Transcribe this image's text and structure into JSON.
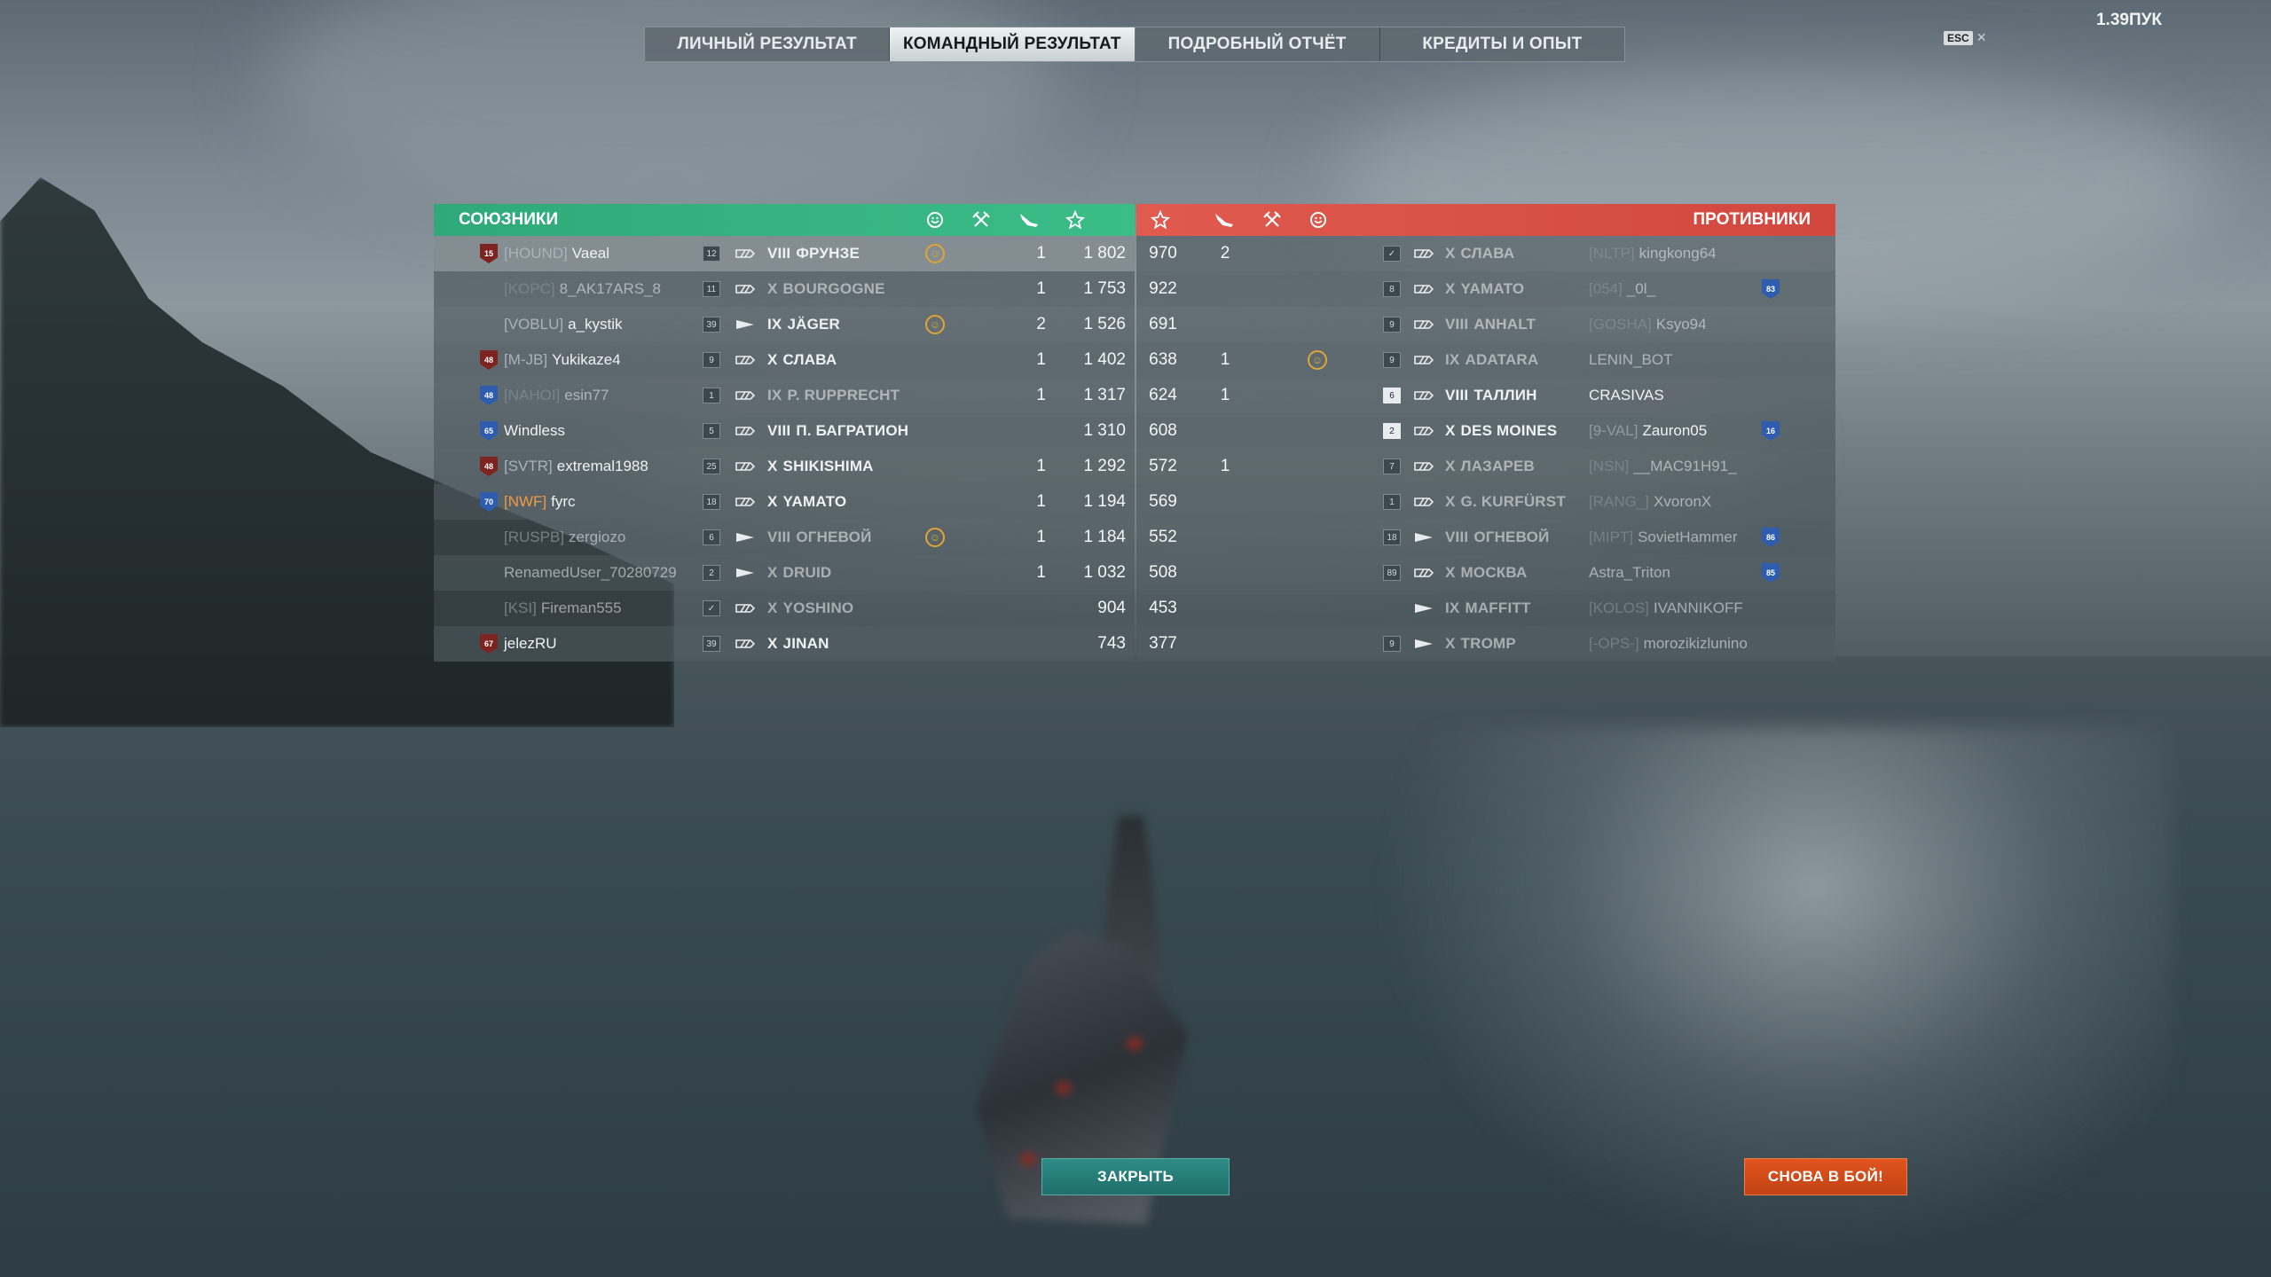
{
  "tabs": [
    "ЛИЧНЫЙ РЕЗУЛЬТАТ",
    "КОМАНДНЫЙ РЕЗУЛЬТАТ",
    "ПОДРОБНЫЙ ОТЧЁТ",
    "КРЕДИТЫ И ОПЫТ"
  ],
  "active_tab": 1,
  "esc_label": "ESC",
  "ping": "1.39ПУК",
  "allies": {
    "title": "СОЮЗНИКИ",
    "header_icons": [
      "medal-icon",
      "crossed-swords-icon",
      "plane-icon",
      "star-icon"
    ],
    "rows": [
      {
        "rank_badge": "15",
        "rank_color": "red",
        "clan": "[HOUND]",
        "clan_style": "normal",
        "player": "Vaeal",
        "level": "12",
        "level_white": false,
        "ship_type": "battleship",
        "tier": "VIII",
        "ship": "ФРУНЗЕ",
        "medal": true,
        "kills": "1",
        "score": "1 802",
        "dim": false,
        "highlight": true
      },
      {
        "rank_badge": "",
        "rank_color": "",
        "clan": "[KOPC]",
        "clan_style": "faded",
        "player": "8_AK17ARS_8",
        "level": "11",
        "level_white": false,
        "ship_type": "battleship",
        "tier": "X",
        "ship": "BOURGOGNE",
        "medal": false,
        "kills": "1",
        "score": "1 753",
        "dim": true,
        "highlight": false
      },
      {
        "rank_badge": "",
        "rank_color": "",
        "clan": "[VOBLU]",
        "clan_style": "normal",
        "player": "a_kystik",
        "level": "39",
        "level_white": false,
        "ship_type": "destroyer",
        "tier": "IX",
        "ship": "JÄGER",
        "medal": true,
        "kills": "2",
        "score": "1 526",
        "dim": false,
        "highlight": false
      },
      {
        "rank_badge": "48",
        "rank_color": "red",
        "clan": "[M-JB]",
        "clan_style": "normal",
        "player": "Yukikaze4",
        "level": "9",
        "level_white": false,
        "ship_type": "battleship",
        "tier": "X",
        "ship": "СЛАВА",
        "medal": false,
        "kills": "1",
        "score": "1 402",
        "dim": false,
        "highlight": false
      },
      {
        "rank_badge": "48",
        "rank_color": "blue",
        "clan": "[NAHOI]",
        "clan_style": "faded",
        "player": "esin77",
        "level": "1",
        "level_white": false,
        "ship_type": "battleship",
        "tier": "IX",
        "ship": "P. RUPPRECHT",
        "medal": false,
        "kills": "1",
        "score": "1 317",
        "dim": true,
        "highlight": false
      },
      {
        "rank_badge": "65",
        "rank_color": "blue",
        "clan": "",
        "clan_style": "normal",
        "player": "Windless",
        "level": "5",
        "level_white": false,
        "ship_type": "battleship",
        "tier": "VIII",
        "ship": "П. БАГРАТИОН",
        "medal": false,
        "kills": "",
        "score": "1 310",
        "dim": false,
        "highlight": false
      },
      {
        "rank_badge": "48",
        "rank_color": "red",
        "clan": "[SVTR]",
        "clan_style": "normal",
        "player": "extremal1988",
        "level": "25",
        "level_white": false,
        "ship_type": "battleship",
        "tier": "X",
        "ship": "SHIKISHIMA",
        "medal": false,
        "kills": "1",
        "score": "1 292",
        "dim": false,
        "highlight": false
      },
      {
        "rank_badge": "70",
        "rank_color": "blue",
        "clan": "[NWF]",
        "clan_style": "orange",
        "player": "fyrc",
        "level": "18",
        "level_white": false,
        "ship_type": "battleship",
        "tier": "X",
        "ship": "YAMATO",
        "medal": false,
        "kills": "1",
        "score": "1 194",
        "dim": false,
        "highlight": false
      },
      {
        "rank_badge": "",
        "rank_color": "",
        "clan": "[RUSPB]",
        "clan_style": "normal",
        "player": "zergiozo",
        "level": "6",
        "level_white": false,
        "ship_type": "destroyer",
        "tier": "VIII",
        "ship": "ОГНЕВОЙ",
        "medal": true,
        "kills": "1",
        "score": "1 184",
        "dim": true,
        "highlight": false
      },
      {
        "rank_badge": "",
        "rank_color": "",
        "clan": "",
        "clan_style": "normal",
        "player": "RenamedUser_70280729",
        "level": "2",
        "level_white": false,
        "ship_type": "destroyer",
        "tier": "X",
        "ship": "DRUID",
        "medal": false,
        "kills": "1",
        "score": "1 032",
        "dim": true,
        "highlight": false
      },
      {
        "rank_badge": "",
        "rank_color": "",
        "clan": "[KSI]",
        "clan_style": "normal",
        "player": "Fireman555",
        "level": "✓",
        "level_white": false,
        "ship_type": "battleship",
        "tier": "X",
        "ship": "YOSHINO",
        "medal": false,
        "kills": "",
        "score": "904",
        "dim": true,
        "highlight": false
      },
      {
        "rank_badge": "67",
        "rank_color": "red",
        "clan": "",
        "clan_style": "normal",
        "player": "jelezRU",
        "level": "39",
        "level_white": false,
        "ship_type": "battleship",
        "tier": "X",
        "ship": "JINAN",
        "medal": false,
        "kills": "",
        "score": "743",
        "dim": false,
        "highlight": false
      }
    ]
  },
  "enemies": {
    "title": "ПРОТИВНИКИ",
    "header_icons": [
      "star-icon",
      "plane-icon",
      "crossed-swords-icon",
      "medal-icon"
    ],
    "rows": [
      {
        "score": "970",
        "kills": "2",
        "medal": false,
        "level": "✓",
        "level_white": false,
        "ship_type": "battleship",
        "tier": "X",
        "ship": "СЛАВА",
        "clan": "[NLTP]",
        "player": "kingkong64",
        "rank_badge": "",
        "dim": true
      },
      {
        "score": "922",
        "kills": "",
        "medal": false,
        "level": "8",
        "level_white": false,
        "ship_type": "battleship",
        "tier": "X",
        "ship": "YAMATO",
        "clan": "[054]",
        "player": "_0l_",
        "rank_badge": "83",
        "dim": true
      },
      {
        "score": "691",
        "kills": "",
        "medal": false,
        "level": "9",
        "level_white": false,
        "ship_type": "battleship",
        "tier": "VIII",
        "ship": "ANHALT",
        "clan": "[GOSHA]",
        "player": "Ksyo94",
        "rank_badge": "",
        "dim": true
      },
      {
        "score": "638",
        "kills": "1",
        "medal": true,
        "level": "9",
        "level_white": false,
        "ship_type": "battleship",
        "tier": "IX",
        "ship": "ADATARA",
        "clan": "",
        "player": "LENIN_BOT",
        "rank_badge": "",
        "dim": true
      },
      {
        "score": "624",
        "kills": "1",
        "medal": false,
        "level": "6",
        "level_white": true,
        "ship_type": "battleship",
        "tier": "VIII",
        "ship": "ТАЛЛИН",
        "clan": "",
        "player": "CRASIVAS",
        "rank_badge": "",
        "dim": false
      },
      {
        "score": "608",
        "kills": "",
        "medal": false,
        "level": "2",
        "level_white": true,
        "ship_type": "battleship",
        "tier": "X",
        "ship": "DES MOINES",
        "clan": "[9-VAL]",
        "player": "Zauron05",
        "rank_badge": "16",
        "dim": false
      },
      {
        "score": "572",
        "kills": "1",
        "medal": false,
        "level": "7",
        "level_white": false,
        "ship_type": "battleship",
        "tier": "X",
        "ship": "ЛАЗАРЕВ",
        "clan": "[NSN]",
        "player": "__MAC91H91_",
        "rank_badge": "",
        "dim": true
      },
      {
        "score": "569",
        "kills": "",
        "medal": false,
        "level": "1",
        "level_white": false,
        "ship_type": "battleship",
        "tier": "X",
        "ship": "G. KURFÜRST",
        "clan": "[RANG_]",
        "player": "XvoronX",
        "rank_badge": "",
        "dim": true
      },
      {
        "score": "552",
        "kills": "",
        "medal": false,
        "level": "18",
        "level_white": false,
        "ship_type": "destroyer",
        "tier": "VIII",
        "ship": "ОГНЕВОЙ",
        "clan": "[MIPT]",
        "player": "SovietHammer",
        "rank_badge": "86",
        "dim": true
      },
      {
        "score": "508",
        "kills": "",
        "medal": false,
        "level": "89",
        "level_white": false,
        "ship_type": "battleship",
        "tier": "X",
        "ship": "МОСКВА",
        "clan": "",
        "player": "Astra_Triton",
        "rank_badge": "85",
        "dim": true
      },
      {
        "score": "453",
        "kills": "",
        "medal": false,
        "level": "",
        "level_white": false,
        "ship_type": "destroyer",
        "tier": "IX",
        "ship": "MAFFITT",
        "clan": "[KOLOS]",
        "player": "IVANNIKOFF",
        "rank_badge": "",
        "dim": true
      },
      {
        "score": "377",
        "kills": "",
        "medal": false,
        "level": "9",
        "level_white": false,
        "ship_type": "destroyer",
        "tier": "X",
        "ship": "TROMP",
        "clan": "[-OPS-]",
        "player": "morozikizlunino",
        "rank_badge": "",
        "dim": true
      }
    ]
  },
  "buttons": {
    "close": "ЗАКРЫТЬ",
    "battle_again": "СНОВА В БОЙ!"
  },
  "colors": {
    "allies": "#3bbd87",
    "enemies": "#d2473f",
    "medal": "#e0a534",
    "battle_button": "#e0541f",
    "close_button": "#2e8b85"
  }
}
